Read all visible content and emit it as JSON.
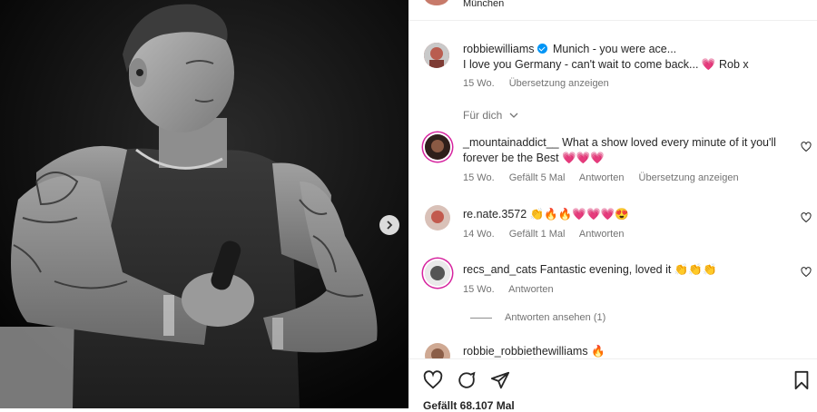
{
  "header": {
    "location": "München"
  },
  "caption": {
    "username": "robbiewilliams",
    "line1": "Munich - you were ace...",
    "line2": "I love you Germany - can't wait to come back...",
    "line2_tail": "Rob x",
    "time": "15 Wo.",
    "translate": "Übersetzung anzeigen"
  },
  "section_label": "Für dich",
  "comments": [
    {
      "username": "_mountainaddict__",
      "text_line1": "What a show loved every minute of it you'll",
      "text_line2": "forever be the Best",
      "time": "15 Wo.",
      "likes": "Gefällt 5 Mal",
      "reply": "Antworten",
      "translate": "Übersetzung anzeigen"
    },
    {
      "username": "re.nate.3572",
      "time": "14 Wo.",
      "likes": "Gefällt 1 Mal",
      "reply": "Antworten"
    },
    {
      "username": "recs_and_cats",
      "text": "Fantastic evening, loved it",
      "time": "15 Wo.",
      "reply": "Antworten"
    },
    {
      "username": "robbie_robbiethewilliams",
      "text": ""
    }
  ],
  "view_replies": "Antworten ansehen (1)",
  "likes_total": "Gefällt 68.107 Mal",
  "icons": {
    "like": "heart-icon",
    "comment": "comment-icon",
    "share": "share-icon",
    "save": "bookmark-icon",
    "next": "chevron-right-icon"
  },
  "colors": {
    "verified": "#0095f6",
    "ring": "#d6249f",
    "muted": "#737373"
  }
}
